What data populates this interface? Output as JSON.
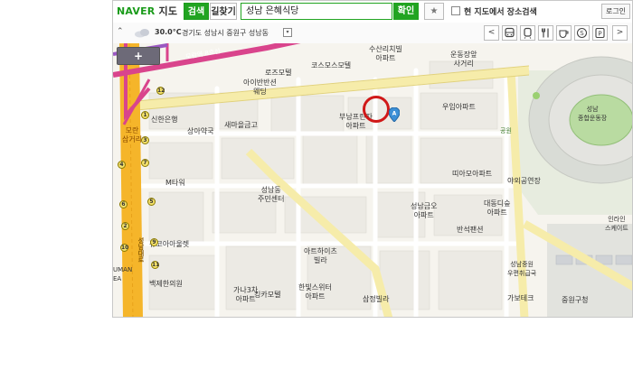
{
  "header": {
    "brand": "NAVER",
    "product": "지도",
    "tabs": [
      {
        "label": "검색",
        "active": true
      },
      {
        "label": "길찾기",
        "active": false
      }
    ],
    "search_value": "성남 은혜식당",
    "search_button": "확인",
    "fav_icon": "★",
    "checkbox_label": "현 지도에서 장소검색",
    "login_label": "로그인"
  },
  "infobar": {
    "collapse_icon": "⌃",
    "temperature": "30.0°C",
    "address": "경기도 성남시 중원구 성남동",
    "dropdown_icon": "▾",
    "nav_prev": "<",
    "nav_next": ">",
    "category_icons": [
      "bus-icon",
      "subway-icon",
      "restaurant-icon",
      "cafe-icon",
      "shopping-icon",
      "parking-icon"
    ]
  },
  "map": {
    "zoom_in_label": "+",
    "labels": {
      "suchan": "수산리치빌\n아파트",
      "sports_front": "운동장앞\n사거리",
      "rose_motel": "로즈모텔",
      "cosmos_motel": "코스모스모텔",
      "ivancien": "아이반반션\n웨딩",
      "moran_road": "모란역 8호선",
      "shinhan": "신한은행",
      "sanga_pharm": "상아약국",
      "saemaul": "새마을금고",
      "boonam_apt": "부남프린자\n아파트",
      "wooim_apt": "우임아파트",
      "stadium": "성남\n종합운동장",
      "moran_cross": "모란\n삼거리",
      "park": "공원",
      "m_tower": "M타워",
      "community": "성남동\n주민센터",
      "dda_apt": "띠아모아파트",
      "arena_apt": "야외공연장",
      "daedong_apt": "대동디숲\n아파트",
      "seongnam_apt": "성남금오\n아파트",
      "banseok": "반석팬션",
      "injin": "인라인\n스케이트",
      "coa_mart": "뉴코아아울렛",
      "ardim_villa": "아트하이츠\n빌라",
      "post": "성남중원\n우편취급국",
      "uman": "UMAN\nEA",
      "baekje": "백제한의원",
      "gana_apt": "가나3차\n아파트",
      "king_motel": "킹카모텔",
      "hanbit_apt": "한빛스위터\n아파트",
      "samjeong": "삼정빌라",
      "gabtech": "가보테크",
      "jungwon_gu": "중원구청",
      "seongnam_daero": "성남대로"
    },
    "subway_exits": [
      "12",
      "1",
      "3",
      "4",
      "5",
      "6",
      "2",
      "9",
      "11",
      "10",
      "7"
    ]
  }
}
